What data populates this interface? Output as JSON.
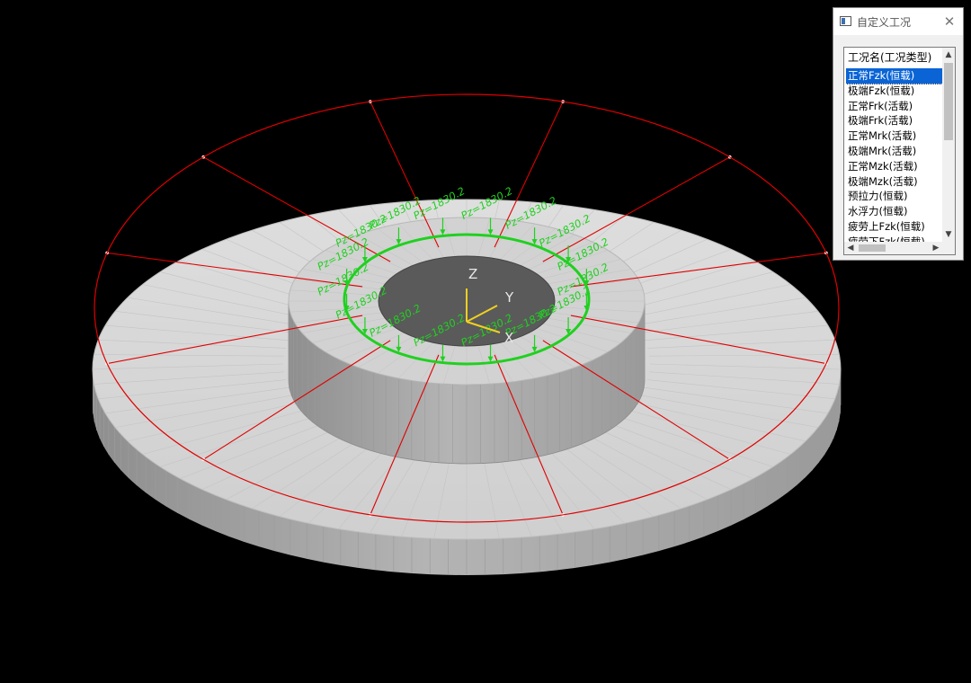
{
  "viewport": {
    "background": "#000000",
    "axes": {
      "z_label": "Z",
      "y_label": "Y",
      "x_label": "X",
      "color": "#f0d020"
    },
    "model": {
      "colors": {
        "top_face": "#d8d8d8",
        "side_face": "#a8a8a8",
        "hole": "#5a5a5a",
        "red_lines": "#e00000",
        "load_green": "#20d020"
      },
      "load_label": "Pz=1830.2",
      "load_count": 16
    }
  },
  "dialog": {
    "title": "自定义工况",
    "close_icon": "close-icon",
    "list": {
      "header": "工况名(工况类型)",
      "items": [
        {
          "label": "正常Fzk(恒载)",
          "selected": true
        },
        {
          "label": "极端Fzk(恒载)",
          "selected": false
        },
        {
          "label": "正常Frk(活载)",
          "selected": false
        },
        {
          "label": "极端Frk(活载)",
          "selected": false
        },
        {
          "label": "正常Mrk(活载)",
          "selected": false
        },
        {
          "label": "极端Mrk(活载)",
          "selected": false
        },
        {
          "label": "正常Mzk(活载)",
          "selected": false
        },
        {
          "label": "极端Mzk(活载)",
          "selected": false
        },
        {
          "label": "预拉力(恒载)",
          "selected": false
        },
        {
          "label": "水浮力(恒载)",
          "selected": false
        },
        {
          "label": "疲劳上Fzk(恒载)",
          "selected": false
        },
        {
          "label": "疲劳下Fzk(恒载)",
          "selected": false
        }
      ],
      "scroll_up_icon": "arrow-up-icon",
      "scroll_down_icon": "arrow-down-icon",
      "scroll_left_icon": "arrow-left-icon",
      "scroll_right_icon": "arrow-right-icon"
    }
  }
}
